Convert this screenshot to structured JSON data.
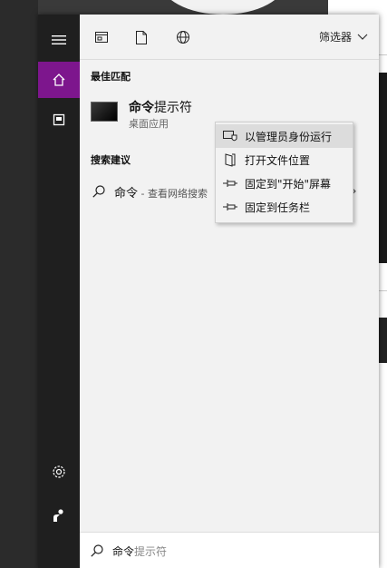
{
  "toolbar": {
    "filter_label": "筛选器"
  },
  "best_match": {
    "title": "最佳匹配",
    "app_name_bold": "命令",
    "app_name_rest": "提示符",
    "app_subtitle": "桌面应用"
  },
  "suggestions": {
    "title": "搜索建议",
    "query": "命令",
    "hint": " - 查看网络搜索"
  },
  "context_menu": {
    "items": [
      {
        "label": "以管理员身份运行",
        "icon": "shield-run-icon"
      },
      {
        "label": "打开文件位置",
        "icon": "folder-open-icon"
      },
      {
        "label": "固定到\"开始\"屏幕",
        "icon": "pin-icon"
      },
      {
        "label": "固定到任务栏",
        "icon": "pin-icon"
      }
    ]
  },
  "search": {
    "typed": "命令",
    "placeholder_rest": "提示符"
  },
  "colors": {
    "accent": "#7d168d",
    "rail": "#1f1f1f",
    "panel": "#f2f2f2"
  }
}
